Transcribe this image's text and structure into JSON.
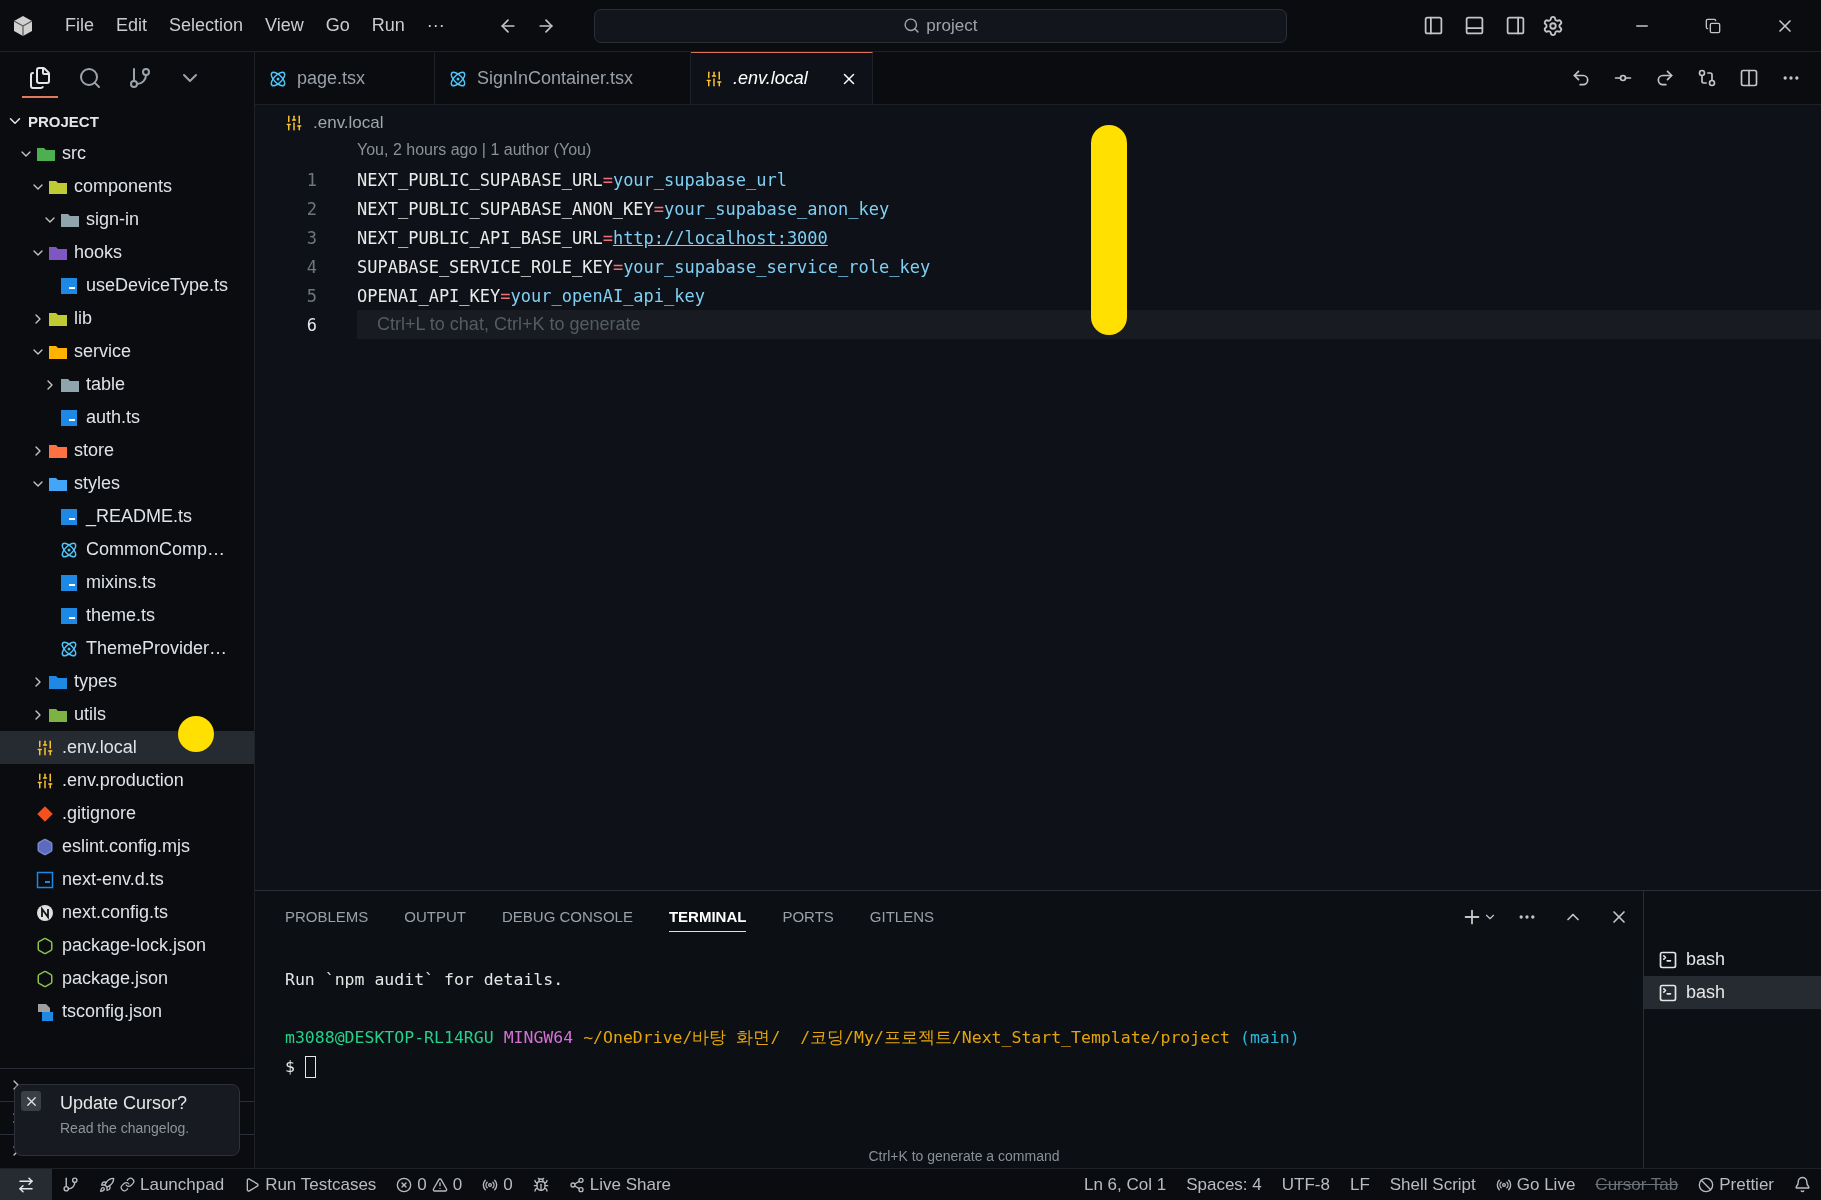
{
  "title_bar": {
    "menu": [
      "File",
      "Edit",
      "Selection",
      "View",
      "Go",
      "Run"
    ],
    "more": "···",
    "search": "project"
  },
  "editor_tabs": [
    {
      "label": "page.tsx",
      "kind": "react",
      "selected": false,
      "preview": false
    },
    {
      "label": "SignInContainer.tsx",
      "kind": "react",
      "selected": false,
      "preview": false
    },
    {
      "label": ".env.local",
      "kind": "env",
      "selected": true,
      "preview": true
    }
  ],
  "sidebar": {
    "title": "PROJECT",
    "tree": [
      {
        "name": "src",
        "kind": "folder",
        "color": "#4caf50",
        "expanded": true,
        "children": [
          {
            "name": "components",
            "kind": "folder",
            "color": "#c0ca33",
            "expanded": true,
            "children": [
              {
                "name": "sign-in",
                "kind": "folder",
                "color": "#90a4ae",
                "expanded": true
              }
            ]
          },
          {
            "name": "hooks",
            "kind": "folder",
            "color": "#7e57c2",
            "expanded": true,
            "children": [
              {
                "name": "useDeviceType.ts",
                "kind": "ts"
              }
            ]
          },
          {
            "name": "lib",
            "kind": "folder",
            "color": "#c0ca33",
            "expanded": false
          },
          {
            "name": "service",
            "kind": "folder",
            "color": "#ffb300",
            "expanded": true,
            "children": [
              {
                "name": "table",
                "kind": "folder",
                "color": "#90a4ae",
                "expanded": false
              },
              {
                "name": "auth.ts",
                "kind": "ts"
              }
            ]
          },
          {
            "name": "store",
            "kind": "folder",
            "color": "#ff7043",
            "expanded": false
          },
          {
            "name": "styles",
            "kind": "folder",
            "color": "#42a5f5",
            "expanded": true,
            "children": [
              {
                "name": "_README.ts",
                "kind": "ts"
              },
              {
                "name": "CommonComp…",
                "kind": "react"
              },
              {
                "name": "mixins.ts",
                "kind": "ts"
              },
              {
                "name": "theme.ts",
                "kind": "ts"
              },
              {
                "name": "ThemeProvider…",
                "kind": "react"
              }
            ]
          },
          {
            "name": "types",
            "kind": "folder",
            "color": "#1e88e5",
            "expanded": false
          },
          {
            "name": "utils",
            "kind": "folder",
            "color": "#7cb342",
            "expanded": false
          }
        ]
      },
      {
        "name": ".env.local",
        "kind": "env",
        "selected": true
      },
      {
        "name": ".env.production",
        "kind": "env",
        "selected": false
      },
      {
        "name": ".gitignore",
        "kind": "git",
        "selected": false
      },
      {
        "name": "eslint.config.mjs",
        "kind": "eslint",
        "selected": false
      },
      {
        "name": "next-env.d.ts",
        "kind": "tsd",
        "selected": false
      },
      {
        "name": "next.config.ts",
        "kind": "next",
        "selected": false
      },
      {
        "name": "package-lock.json",
        "kind": "node",
        "selected": false
      },
      {
        "name": "package.json",
        "kind": "node",
        "selected": false
      },
      {
        "name": "tsconfig.json",
        "kind": "tsconfig",
        "selected": false
      }
    ]
  },
  "toast": {
    "title": "Update Cursor?",
    "message": "Read the changelog."
  },
  "editor": {
    "breadcrumb": ".env.local",
    "blame": "You, 2 hours ago | 1 author (You)",
    "lines": [
      {
        "number": "1",
        "key": "NEXT_PUBLIC_SUPABASE_URL",
        "sign": "=",
        "value": "your_supabase_url",
        "link": false,
        "current": false
      },
      {
        "number": "2",
        "key": "NEXT_PUBLIC_SUPABASE_ANON_KEY",
        "sign": "=",
        "value": "your_supabase_anon_key",
        "link": false,
        "current": false
      },
      {
        "number": "3",
        "key": "NEXT_PUBLIC_API_BASE_URL",
        "sign": "=",
        "value": "http://localhost:3000",
        "link": true,
        "current": false
      },
      {
        "number": "4",
        "key": "SUPABASE_SERVICE_ROLE_KEY",
        "sign": "=",
        "value": "your_supabase_service_role_key",
        "link": false,
        "current": false
      },
      {
        "number": "5",
        "key": "OPENAI_API_KEY",
        "sign": "=",
        "value": "your_openAI_api_key",
        "link": false,
        "current": false
      },
      {
        "number": "6",
        "hint": "Ctrl+L to chat, Ctrl+K to generate",
        "current": true
      }
    ]
  },
  "panel": {
    "tabs": [
      {
        "label": "PROBLEMS",
        "selected": false
      },
      {
        "label": "OUTPUT",
        "selected": false
      },
      {
        "label": "DEBUG CONSOLE",
        "selected": false
      },
      {
        "label": "TERMINAL",
        "selected": true
      },
      {
        "label": "PORTS",
        "selected": false
      },
      {
        "label": "GITLENS",
        "selected": false
      }
    ],
    "output": "Run `npm audit` for details.",
    "prompt": [
      {
        "text": "m3088@DESKTOP-RL14RGU",
        "color": "#23d18b"
      },
      {
        "text": "MINGW64",
        "color": "#d670d6"
      },
      {
        "text": "~/OneDrive/바탕 화면/  /코딩/My/프로젝트/Next_Start_Template/project",
        "color": "#e5a50a"
      },
      {
        "text": "(main)",
        "color": "#29b8db"
      }
    ],
    "cursor_line": "$",
    "hint": "Ctrl+K to generate a command",
    "terminals": [
      {
        "label": "bash",
        "selected": false
      },
      {
        "label": "bash",
        "selected": true
      }
    ]
  },
  "status_bar": {
    "left": [
      {
        "kind": "launchpad",
        "text": "Launchpad"
      },
      {
        "kind": "run",
        "text": "Run Testcases"
      },
      {
        "kind": "problems",
        "errors": "0",
        "warnings": "0"
      },
      {
        "kind": "ports",
        "text": "0"
      },
      {
        "kind": "debug"
      },
      {
        "kind": "share",
        "text": "Live Share"
      }
    ],
    "right": [
      {
        "text": "Ln 6, Col 1",
        "disabled": false
      },
      {
        "text": "Spaces: 4",
        "disabled": false
      },
      {
        "text": "UTF-8",
        "disabled": false
      },
      {
        "text": "LF",
        "disabled": false
      },
      {
        "text": "Shell Script",
        "disabled": false
      },
      {
        "text": "Go Live",
        "disabled": false,
        "kind": "live"
      },
      {
        "text": "Cursor Tab",
        "disabled": true
      },
      {
        "text": "Prettier",
        "disabled": false,
        "kind": "prettier"
      }
    ]
  }
}
